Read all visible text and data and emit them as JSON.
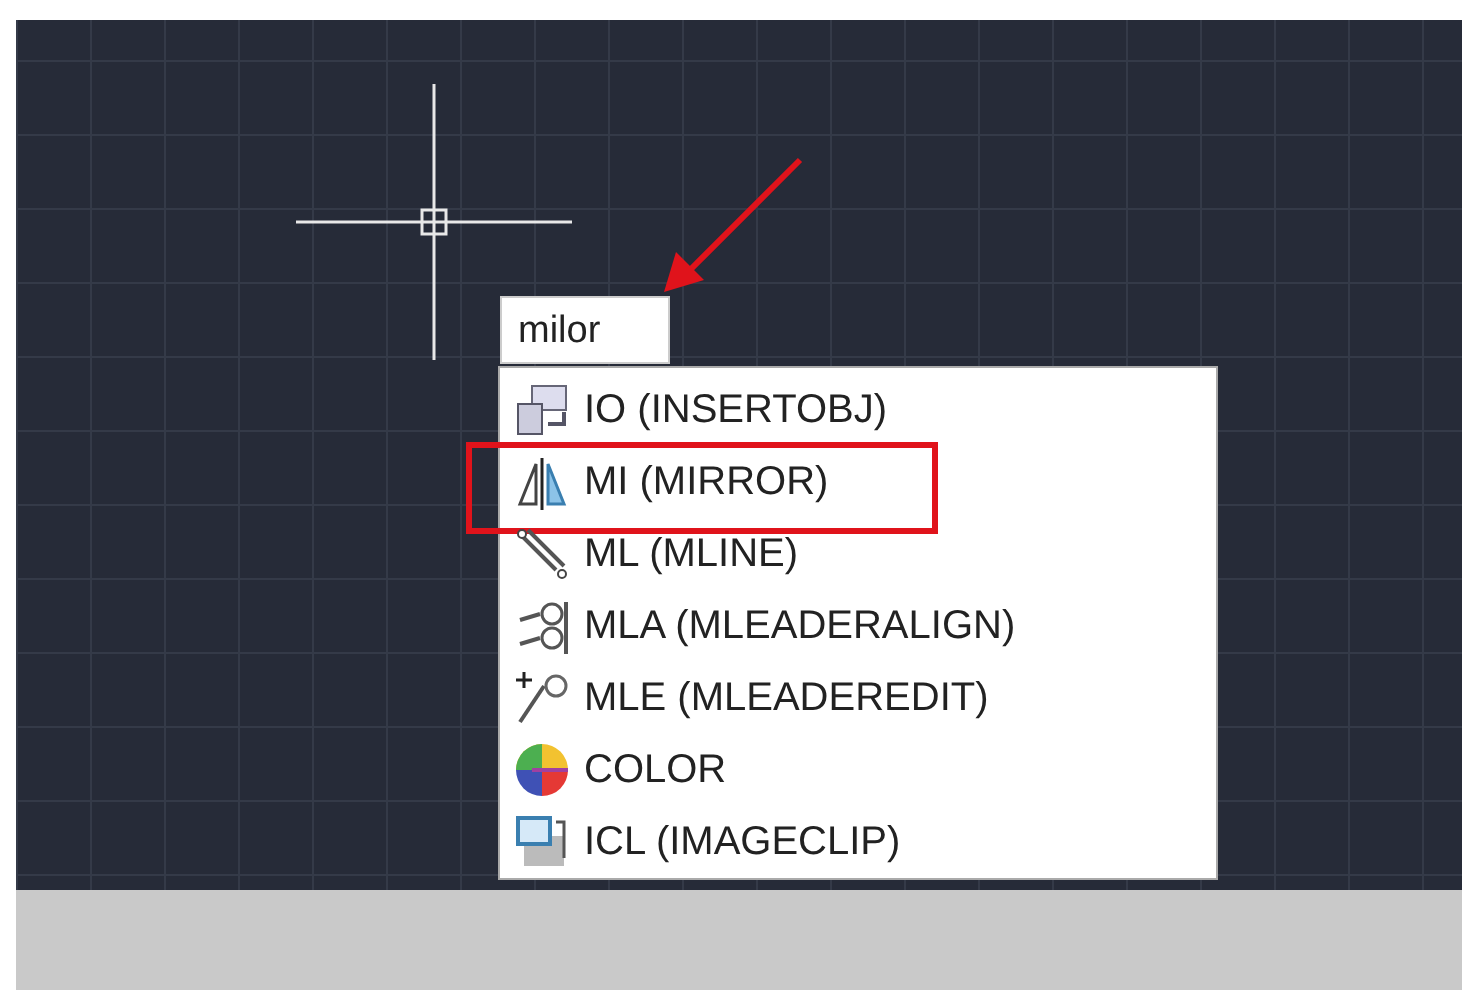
{
  "command_input": {
    "value": "milor"
  },
  "suggestions": [
    {
      "label": "IO (INSERTOBJ)",
      "highlighted": false
    },
    {
      "label": "MI (MIRROR)",
      "highlighted": true
    },
    {
      "label": "ML (MLINE)",
      "highlighted": false
    },
    {
      "label": "MLA (MLEADERALIGN)",
      "highlighted": false
    },
    {
      "label": "MLE (MLEADEREDIT)",
      "highlighted": false
    },
    {
      "label": "COLOR",
      "highlighted": false
    },
    {
      "label": "ICL (IMAGECLIP)",
      "highlighted": false
    }
  ]
}
